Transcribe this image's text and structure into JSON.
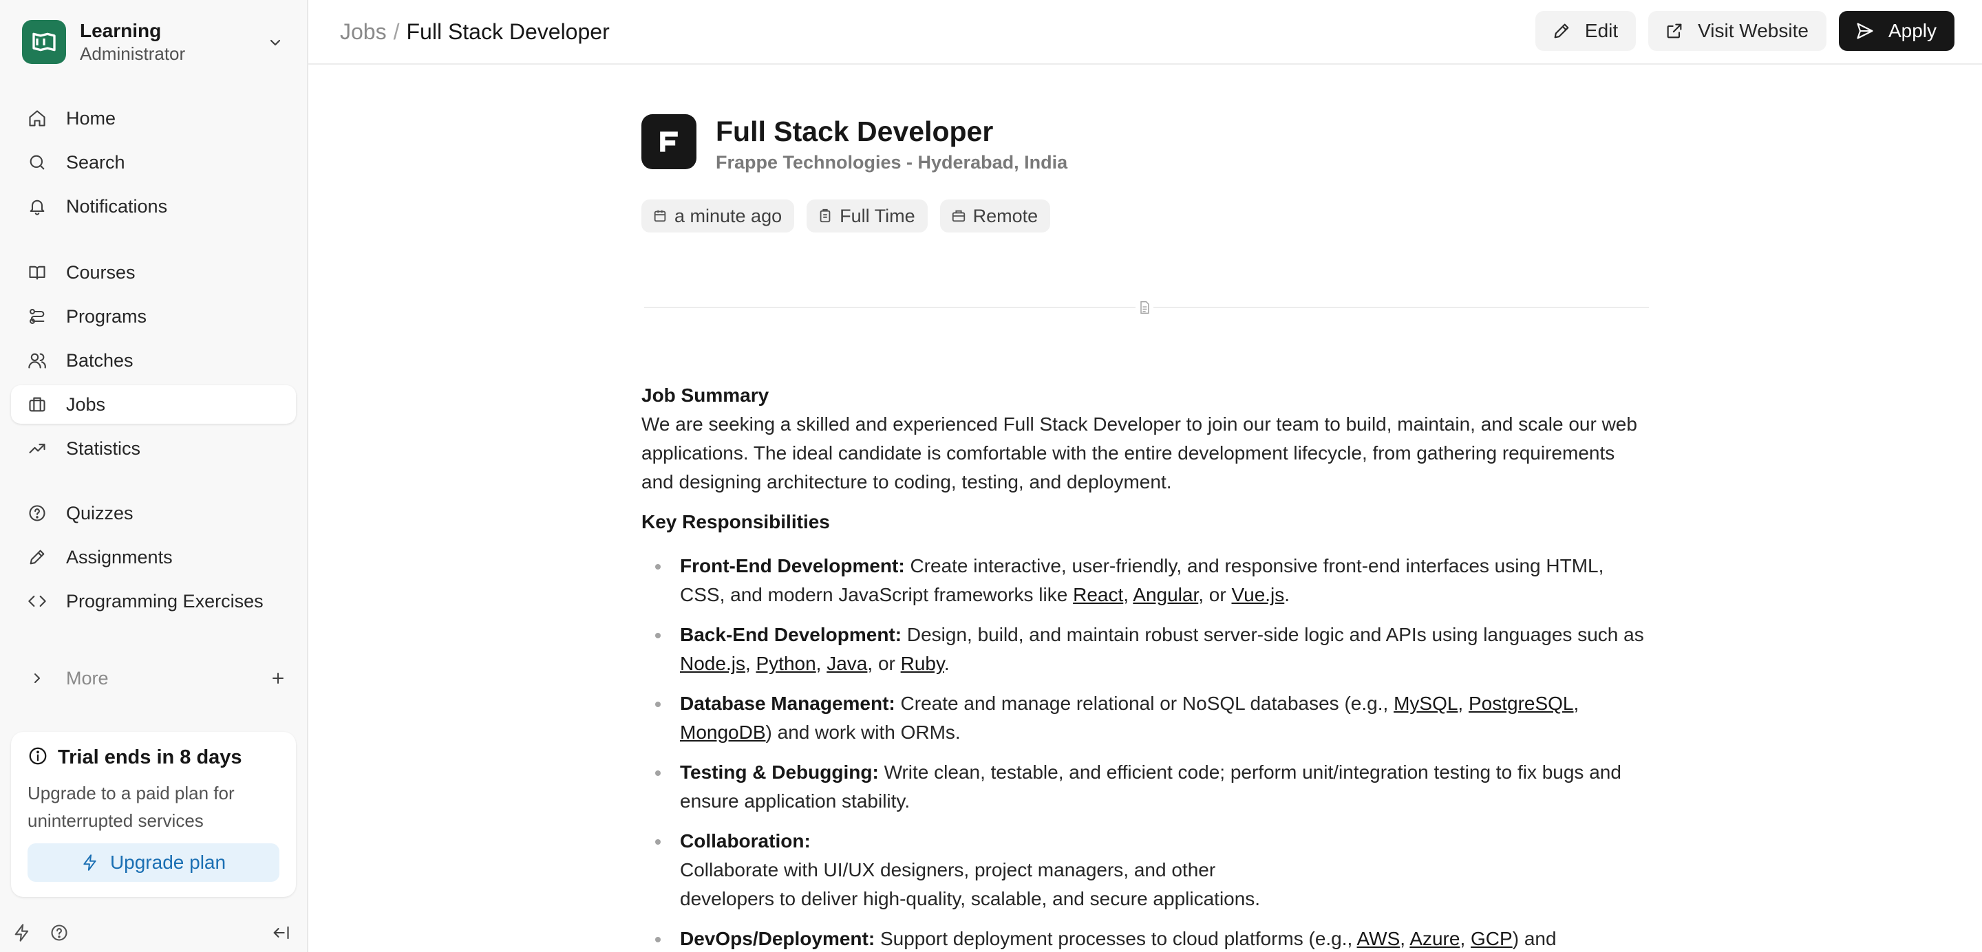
{
  "sidebar": {
    "brand": {
      "title": "Learning",
      "subtitle": "Administrator",
      "color": "#1f7a55"
    },
    "nav_primary": [
      {
        "label": "Home",
        "icon": "home-icon"
      },
      {
        "label": "Search",
        "icon": "search-icon"
      },
      {
        "label": "Notifications",
        "icon": "bell-icon"
      }
    ],
    "nav_learning": [
      {
        "label": "Courses",
        "icon": "book-icon"
      },
      {
        "label": "Programs",
        "icon": "route-icon"
      },
      {
        "label": "Batches",
        "icon": "users-icon"
      },
      {
        "label": "Jobs",
        "icon": "briefcase-icon",
        "active": true
      },
      {
        "label": "Statistics",
        "icon": "trending-up-icon"
      }
    ],
    "nav_assess": [
      {
        "label": "Quizzes",
        "icon": "help-circle-icon"
      },
      {
        "label": "Assignments",
        "icon": "pencil-icon"
      },
      {
        "label": "Programming Exercises",
        "icon": "code-icon"
      }
    ],
    "more_label": "More",
    "trial": {
      "title": "Trial ends in 8 days",
      "description": "Upgrade to a paid plan for uninterrupted services",
      "button": "Upgrade plan"
    }
  },
  "topbar": {
    "breadcrumb_parent": "Jobs",
    "breadcrumb_sep": "/",
    "breadcrumb_current": "Full Stack Developer",
    "edit": "Edit",
    "visit": "Visit Website",
    "apply": "Apply"
  },
  "job": {
    "title": "Full Stack Developer",
    "company": "Frappe Technologies - Hyderabad, India",
    "tags": [
      "a minute ago",
      "Full Time",
      "Remote"
    ],
    "summary_heading": "Job Summary",
    "summary": "We are seeking a skilled and experienced Full Stack Developer to join our team to build, maintain, and scale our web applications. The ideal candidate is comfortable with the entire development lifecycle, from gathering requirements and designing architecture to coding, testing, and deployment.",
    "resp_heading": "Key Responsibilities",
    "responsibilities": {
      "fe_title": "Front-End Development:",
      "fe_text": "Create interactive, user-friendly, and responsive front-end interfaces using HTML, CSS, and modern JavaScript frameworks like",
      "fe_links": [
        "React",
        "Angular",
        "Vue.js"
      ],
      "be_title": "Back-End Development:",
      "be_text": "Design, build, and maintain robust server-side logic and APIs using languages such as",
      "be_links": [
        "Node.js",
        "Python",
        "Java",
        "Ruby"
      ],
      "db_title": "Database Management:",
      "db_text": "Create and manage relational or NoSQL databases (e.g.,",
      "db_links": [
        "MySQL",
        "PostgreSQL",
        "MongoDB"
      ],
      "db_tail": ") and work with ORMs.",
      "test_title": "Testing & Debugging:",
      "test_text": "Write clean, testable, and efficient code; perform unit/integration testing to fix bugs and ensure application stability.",
      "collab_title": "Collaboration:",
      "collab_line1": "Collaborate with UI/UX designers, project managers, and other",
      "collab_line2": "developers to deliver high-quality, scalable, and secure applications.",
      "devops_title": "DevOps/Deployment:",
      "devops_text": "Support deployment processes to cloud platforms (e.g.,",
      "devops_links": [
        "AWS",
        "Azure",
        "GCP"
      ],
      "devops_tail": ") and"
    }
  }
}
